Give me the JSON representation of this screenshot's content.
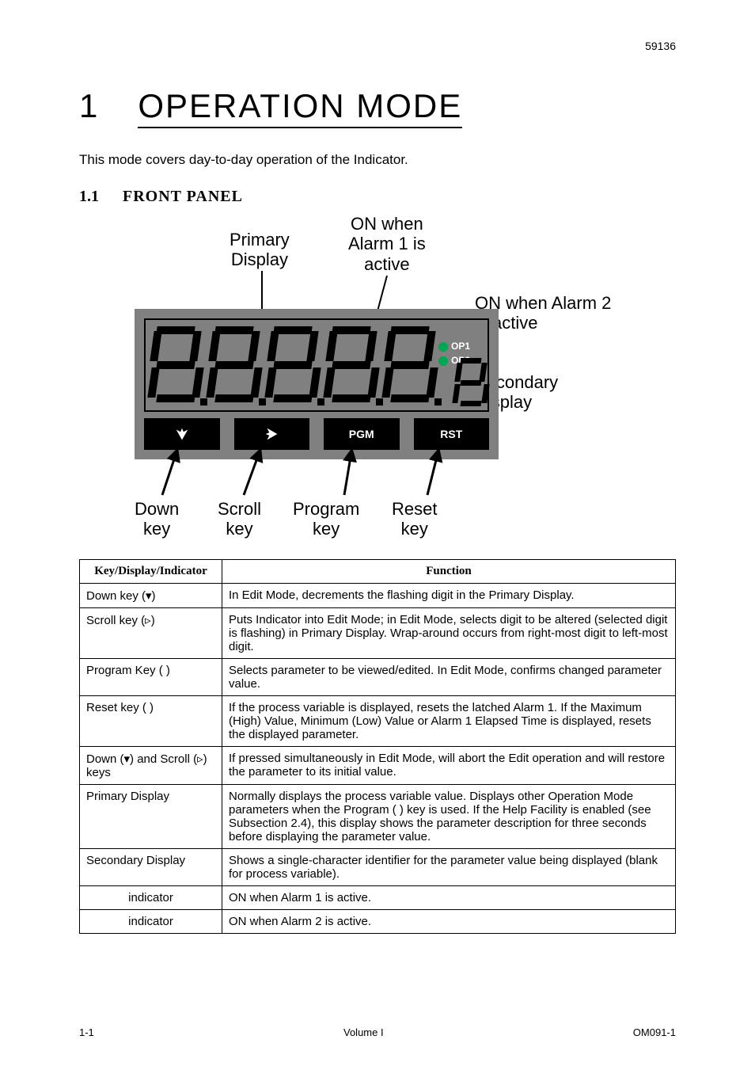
{
  "header": {
    "doc_num": "59136"
  },
  "chapter": {
    "num": "1",
    "title": "OPERATION MODE"
  },
  "intro": "This mode covers day-to-day operation of the Indicator.",
  "section": {
    "num": "1.1",
    "title": "FRONT PANEL"
  },
  "figure": {
    "labels": {
      "primary_display": "Primary\nDisplay",
      "alarm1": "ON when\nAlarm 1 is\nactive",
      "alarm2": "ON when Alarm 2\nis active",
      "secondary_display": "Secondary\nDisplay",
      "down_key": "Down\nkey",
      "scroll_key": "Scroll\nkey",
      "program_key": "Program\nkey",
      "reset_key": "Reset\nkey"
    },
    "panel": {
      "op1_text": "OP1",
      "op2_text": "OP2",
      "btn_pgm": "PGM",
      "btn_rst": "RST"
    }
  },
  "table": {
    "headers": [
      "Key/Display/Indicator",
      "Function"
    ],
    "rows": [
      {
        "key": "Down key (▾)",
        "func": "In Edit Mode, decrements the flashing digit in the Primary Display."
      },
      {
        "key": "Scroll key (▹)",
        "func": "Puts Indicator into Edit Mode; in Edit Mode, selects digit to be altered (selected digit is flashing) in Primary Display. Wrap-around occurs from right-most digit to left-most digit."
      },
      {
        "key": "Program Key (        )",
        "func": "Selects parameter to be viewed/edited. In Edit Mode, confirms changed parameter value."
      },
      {
        "key": "Reset key (        )",
        "func": "If the process variable is displayed, resets the latched Alarm 1. If the Maximum (High) Value, Minimum (Low) Value or Alarm 1 Elapsed Time is displayed, resets the displayed parameter."
      },
      {
        "key": "Down (▾) and Scroll (▹) keys",
        "func": "If pressed simultaneously in Edit Mode, will abort the Edit operation and will restore the parameter to its initial value."
      },
      {
        "key": "Primary Display",
        "func": "Normally displays the process variable value. Displays other Operation Mode parameters when the Program (        ) key is used. If the Help Facility is enabled (see Subsection 2.4), this display shows the parameter description for three seconds before displaying the parameter value."
      },
      {
        "key": "Secondary Display",
        "func": "Shows a single-character identifier for the parameter value being displayed (blank for process variable)."
      },
      {
        "key": "indicator",
        "func": "ON when Alarm 1 is active.",
        "centered": true
      },
      {
        "key": "indicator",
        "func": "ON when Alarm 2 is active.",
        "centered": true
      }
    ]
  },
  "footer": {
    "left": "1-1",
    "center": "Volume I",
    "right": "OM091-1"
  }
}
